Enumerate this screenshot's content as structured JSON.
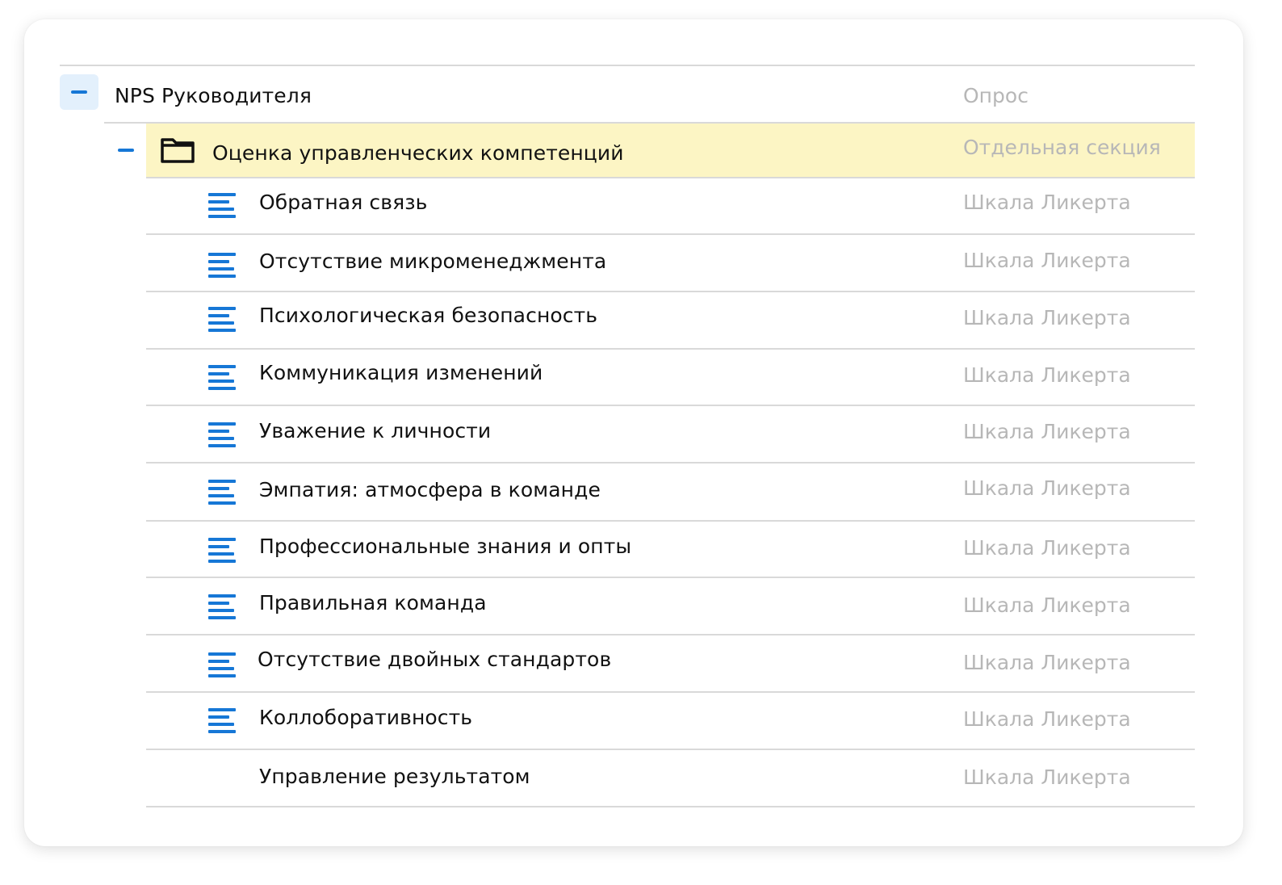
{
  "colors": {
    "accent": "#1677d6",
    "highlight": "#fcf5c4",
    "muted_text": "#b7b7b7"
  },
  "root": {
    "title": "NPS Руководителя",
    "type": "Опрос",
    "toggle_icon": "minus-icon"
  },
  "section": {
    "title": "Оценка управленческих компетенций",
    "type": "Отдельная секция",
    "toggle_icon": "minus-icon",
    "icon": "folder-icon"
  },
  "items": [
    {
      "label": "Обратная связь",
      "type": "Шкала Ликерта",
      "icon": "text-lines-icon"
    },
    {
      "label": "Отсутствие микроменеджмента",
      "type": "Шкала Ликерта",
      "icon": "text-lines-icon"
    },
    {
      "label": "Психологическая безопасность",
      "type": "Шкала Ликерта",
      "icon": "text-lines-icon"
    },
    {
      "label": "Коммуникация изменений",
      "type": "Шкала Ликерта",
      "icon": "text-lines-icon"
    },
    {
      "label": "Уважение к личности",
      "type": "Шкала Ликерта",
      "icon": "text-lines-icon"
    },
    {
      "label": "Эмпатия: атмосфера в команде",
      "type": "Шкала Ликерта",
      "icon": "text-lines-icon"
    },
    {
      "label": "Профессиональные знания и опты",
      "type": "Шкала Ликерта",
      "icon": "text-lines-icon"
    },
    {
      "label": "Правильная команда",
      "type": "Шкала Ликерта",
      "icon": "text-lines-icon"
    },
    {
      "label": "Отсутствие двойных стандартов",
      "type": "Шкала Ликерта",
      "icon": "text-lines-icon"
    },
    {
      "label": "Коллоборативность",
      "type": "Шкала Ликерта",
      "icon": "text-lines-icon"
    },
    {
      "label": "Управление результатом",
      "type": "Шкала Ликерта",
      "icon": ""
    }
  ]
}
